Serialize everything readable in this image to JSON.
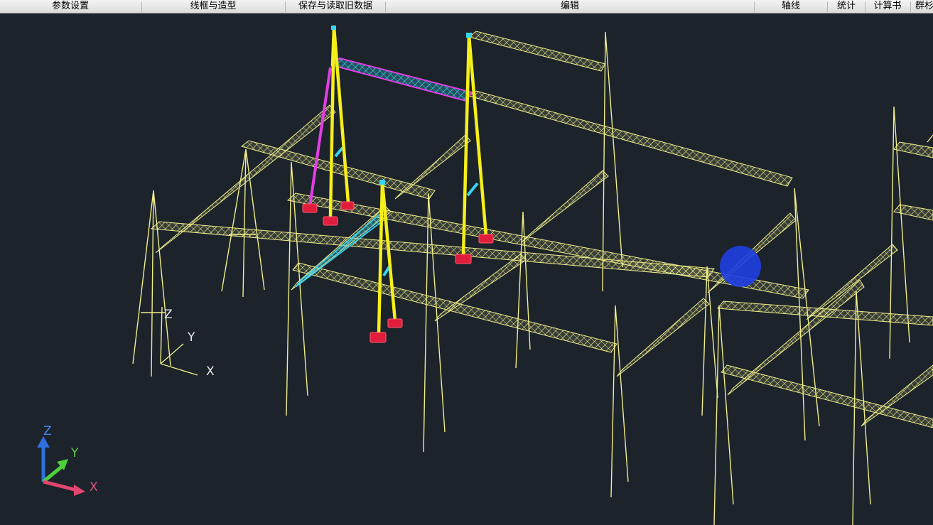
{
  "menubar": {
    "items": [
      {
        "label": "参数设置"
      },
      {
        "label": "线框与造型"
      },
      {
        "label": "保存与读取旧数据"
      },
      {
        "label": "编辑"
      },
      {
        "label": "轴线"
      },
      {
        "label": "统计"
      },
      {
        "label": "计算书"
      },
      {
        "label": "群杉"
      }
    ]
  },
  "viewport": {
    "ucs": {
      "z": "Z",
      "y": "Y",
      "x": "X"
    },
    "nav_axes": {
      "z": "Z",
      "y": "Y",
      "x": "X"
    }
  },
  "colors": {
    "background": "#1d232b",
    "wireframe": "#f0ee8a",
    "column": "#f5ef1a",
    "cyan_beam": "#36d6f2",
    "magenta": "#e33ee6",
    "base": "#e01e3c",
    "cursor": "#1f3fe0"
  }
}
